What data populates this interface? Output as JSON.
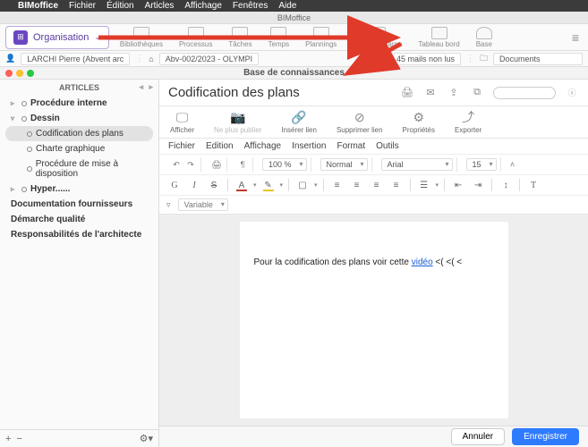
{
  "menubar": {
    "app": "BIMoffice",
    "items": [
      "Fichier",
      "Édition",
      "Articles",
      "Affichage",
      "Fenêtres",
      "Aide"
    ]
  },
  "window_title": "BIMoffice",
  "org_button": {
    "label": "Organisation"
  },
  "toolbar": [
    {
      "label": "Bibliothèques"
    },
    {
      "label": "Processus"
    },
    {
      "label": "Tâches"
    },
    {
      "label": "Temps"
    },
    {
      "label": "Plannings"
    },
    {
      "label": "Analyse charge"
    },
    {
      "label": "Tableau bord"
    },
    {
      "label": "Base"
    }
  ],
  "row2": {
    "user": "LARCHI Pierre (Abvent arc",
    "project": "Abv-002/2023 - OLYMPI",
    "mails": "45 mails non lus",
    "docs": "Documents"
  },
  "kb_title": "Base de connaissances",
  "sidebar": {
    "header": "ARTICLES",
    "nodes": {
      "n0": "Procédure interne",
      "n1": "Dessin",
      "n1a": "Codification des plans",
      "n1b": "Charte graphique",
      "n1c": "Procédure de mise à disposition",
      "n2": "Hyper......",
      "n3": "Documentation fournisseurs",
      "n4": "Démarche qualité",
      "n5": "Responsabilités de l'architecte"
    }
  },
  "main": {
    "title": "Codification des plans",
    "actions": {
      "show": "Afficher",
      "nopub": "Ne plus publier",
      "insertlink": "Insérer lien",
      "dellink": "Supprimer lien",
      "props": "Propriétés",
      "export": "Exporter"
    },
    "menus": [
      "Fichier",
      "Edition",
      "Affichage",
      "Insertion",
      "Format",
      "Outils"
    ],
    "format": {
      "zoom": "100 %",
      "style": "Normal",
      "font": "Arial",
      "size": "15",
      "variable": "Variable"
    },
    "body_text": "Pour la codification des plans voir cette ",
    "body_link": "vidéo",
    "body_tail": " <( <( <"
  },
  "footer": {
    "cancel": "Annuler",
    "save": "Enregistrer"
  }
}
